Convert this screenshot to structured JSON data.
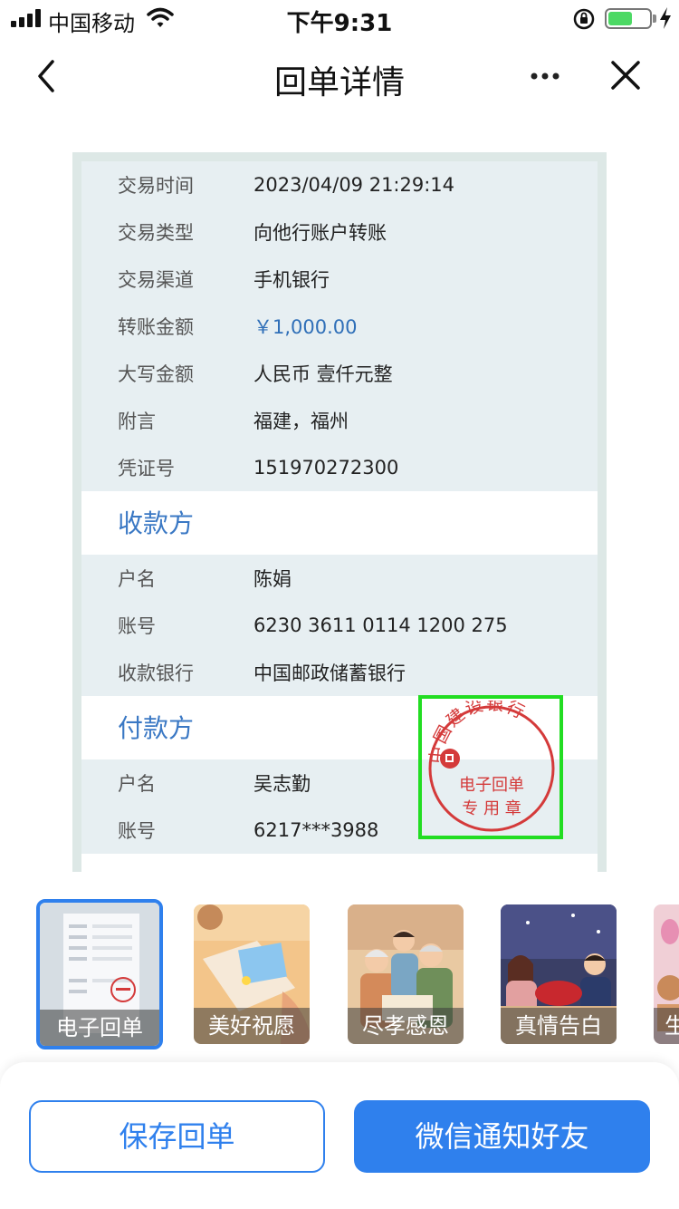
{
  "status_bar": {
    "carrier": "中国移动",
    "time": "下午9:31",
    "battery_level": 0.6,
    "colors": {
      "battery": "#4cd964"
    }
  },
  "nav": {
    "title": "回单详情",
    "icons": [
      "chevron-left-icon",
      "more-icon",
      "close-icon"
    ]
  },
  "receipt": {
    "details": [
      {
        "label": "交易时间",
        "value": "2023/04/09 21:29:14"
      },
      {
        "label": "交易类型",
        "value": "向他行账户转账"
      },
      {
        "label": "交易渠道",
        "value": "手机银行"
      },
      {
        "label": "转账金额",
        "value": "￥1,000.00"
      },
      {
        "label": "大写金额",
        "value": "人民币 壹仟元整"
      },
      {
        "label": "附言",
        "value": "福建，福州"
      },
      {
        "label": "凭证号",
        "value": "151970272300"
      }
    ],
    "payee": {
      "title": "收款方",
      "rows": [
        {
          "label": "户名",
          "value": "陈娟"
        },
        {
          "label": "账号",
          "value": "6230 3611 0114 1200 275"
        },
        {
          "label": "收款银行",
          "value": "中国邮政储蓄银行"
        }
      ]
    },
    "payer": {
      "title": "付款方",
      "rows": [
        {
          "label": "户名",
          "value": "吴志勤"
        },
        {
          "label": "账号",
          "value": "6217***3988"
        }
      ]
    },
    "stamp": {
      "arc_text": "中国建设银行",
      "line1": "电子回单",
      "line2": "专 用 章"
    }
  },
  "templates": [
    {
      "label": "电子回单",
      "selected": true
    },
    {
      "label": "美好祝愿",
      "selected": false
    },
    {
      "label": "尽孝感恩",
      "selected": false
    },
    {
      "label": "真情告白",
      "selected": false
    },
    {
      "label": "生",
      "selected": false
    }
  ],
  "actions": {
    "save_label": "保存回单",
    "wechat_label": "微信通知好友"
  },
  "colors": {
    "accent": "#2f80ed",
    "section_title": "#3a78c4",
    "stamp_red": "#d43a3a",
    "amount": "#2f6fb8"
  }
}
